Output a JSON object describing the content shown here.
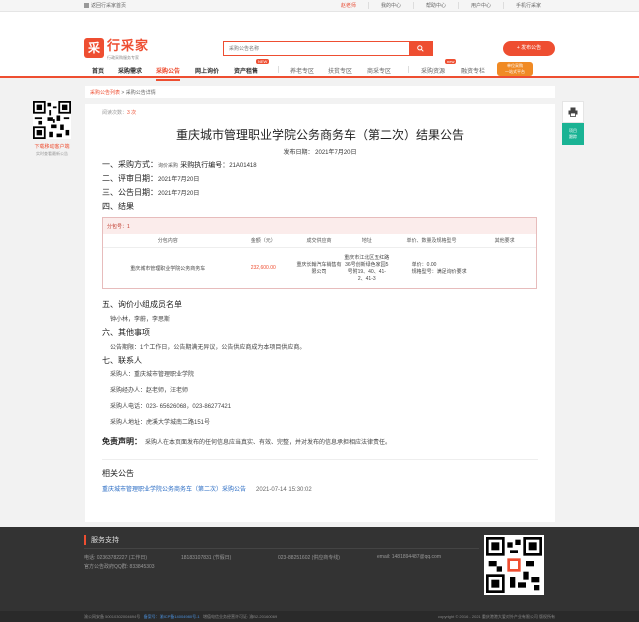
{
  "topbar": {
    "home_link": "返回行采家首页",
    "user": "赵老师",
    "links": [
      "我的中心",
      "帮助中心",
      "用户中心",
      "手机行采家"
    ]
  },
  "header": {
    "logo_mark": "采",
    "logo_name": "行采家",
    "logo_slogan": "行政采购服务专家",
    "search_placeholder": "采购公告名称",
    "publish_label": "发布公告"
  },
  "nav": {
    "items": [
      {
        "label": "首页"
      },
      {
        "label": "采购需求"
      },
      {
        "label": "采购公告"
      },
      {
        "label": "网上询价"
      },
      {
        "label": "资产租售"
      },
      {
        "label": "养老专区"
      },
      {
        "label": "扶贫专区"
      },
      {
        "label": "商采专区"
      },
      {
        "label": "采购资源"
      },
      {
        "label": "融资专栏"
      }
    ],
    "badge_new": "NEW",
    "badge_new2": "new",
    "promo_line1": "单位采购",
    "promo_line2": "一站式平台",
    "accent": "#ee4e31"
  },
  "leftfloat": {
    "text1": "下载移动客户端",
    "text2": "实时查看最新公告"
  },
  "rightfloat": {
    "print_icon": "print-icon",
    "green_line1": "项目",
    "green_line2": "跟踪"
  },
  "breadcrumb": {
    "part1": "采购公告列表",
    "separator": " > ",
    "part2": "采购公告详情"
  },
  "notice": {
    "views_label": "阅读次数：",
    "views_count": "3 次",
    "title": "重庆城市管理职业学院公务商务车（第二次）结果公告",
    "publish_date": "发布日期：  2021年7月20日",
    "s1_label": "一、采购方式：",
    "s1_value": "询价采购",
    "s1_code_label": "采购执行编号：",
    "s1_code": "21A01418",
    "s2_label": "二、评审日期：",
    "s2_value": "2021年7月20日",
    "s3_label": "三、公告日期：",
    "s3_value": "2021年7月20日",
    "s4_label": "四、结果",
    "package": "分包号：1",
    "table_headers": [
      "分包内容",
      "金额（元）",
      "成交供应商",
      "地址",
      "单价、数量及规格型号",
      "其他要求"
    ],
    "table_row": {
      "content": "重庆城市管理职业学院公务商务车",
      "amount": "232,600.00",
      "supplier": "重庆长翰汽车销售有限公司",
      "address": "重庆市江北区五红路36号创新绿色家园5号附19、40、41-2、41-3",
      "price_line1": "单价：0.00",
      "price_line2": "规格型号：满足询价要求",
      "other": ""
    },
    "s5_label": "五、询价小组成员名单",
    "s5_value": "钟小林，李蔚，李思斯",
    "s6_label": "六、其他事项",
    "s6_value": "公告期限：1个工作日，公告期满无异议，公告供应商成为本项目供应商。",
    "s7_label": "七、联系人",
    "contacts": [
      "采购人：重庆城市管理职业学院",
      "采购经办人：赵老师，汪老师",
      "采购人电话：023- 65626068，023-86277421",
      "采购人地址：虎溪大学城南二路151号"
    ],
    "disclaimer_label": "免责声明：",
    "disclaimer_text": "采购人在本页面发布的任何信息应当真实、有效、完整，并对发布的信息承担相应法律责任。",
    "related_label": "相关公告",
    "related": [
      {
        "title": "重庆城市管理职业学院公务商务车（第二次）采购公告",
        "date": "2021-07-14 15:30:02"
      }
    ]
  },
  "footer": {
    "heading": "服务支持",
    "items": [
      "电话: 02363782227 (工作日)",
      "18183107831 (节假日)",
      "023-88251602 (供应商专线)",
      "email: 1481894487@qq.com"
    ],
    "qq": "官方公告政府QQ群: 833845303",
    "bottom_left_a": "渝公网安备 50010302004694号",
    "bottom_left_b": "备案号：",
    "bottom_left_c": "渝ICP备14004980号-1",
    "bottom_left_d": "增值电信业务经营许可证: 渝B2-20160069",
    "bottom_right": "copyright © 2016 - 2021 重庆港港大爱对外产业有限公司 版权所有"
  }
}
